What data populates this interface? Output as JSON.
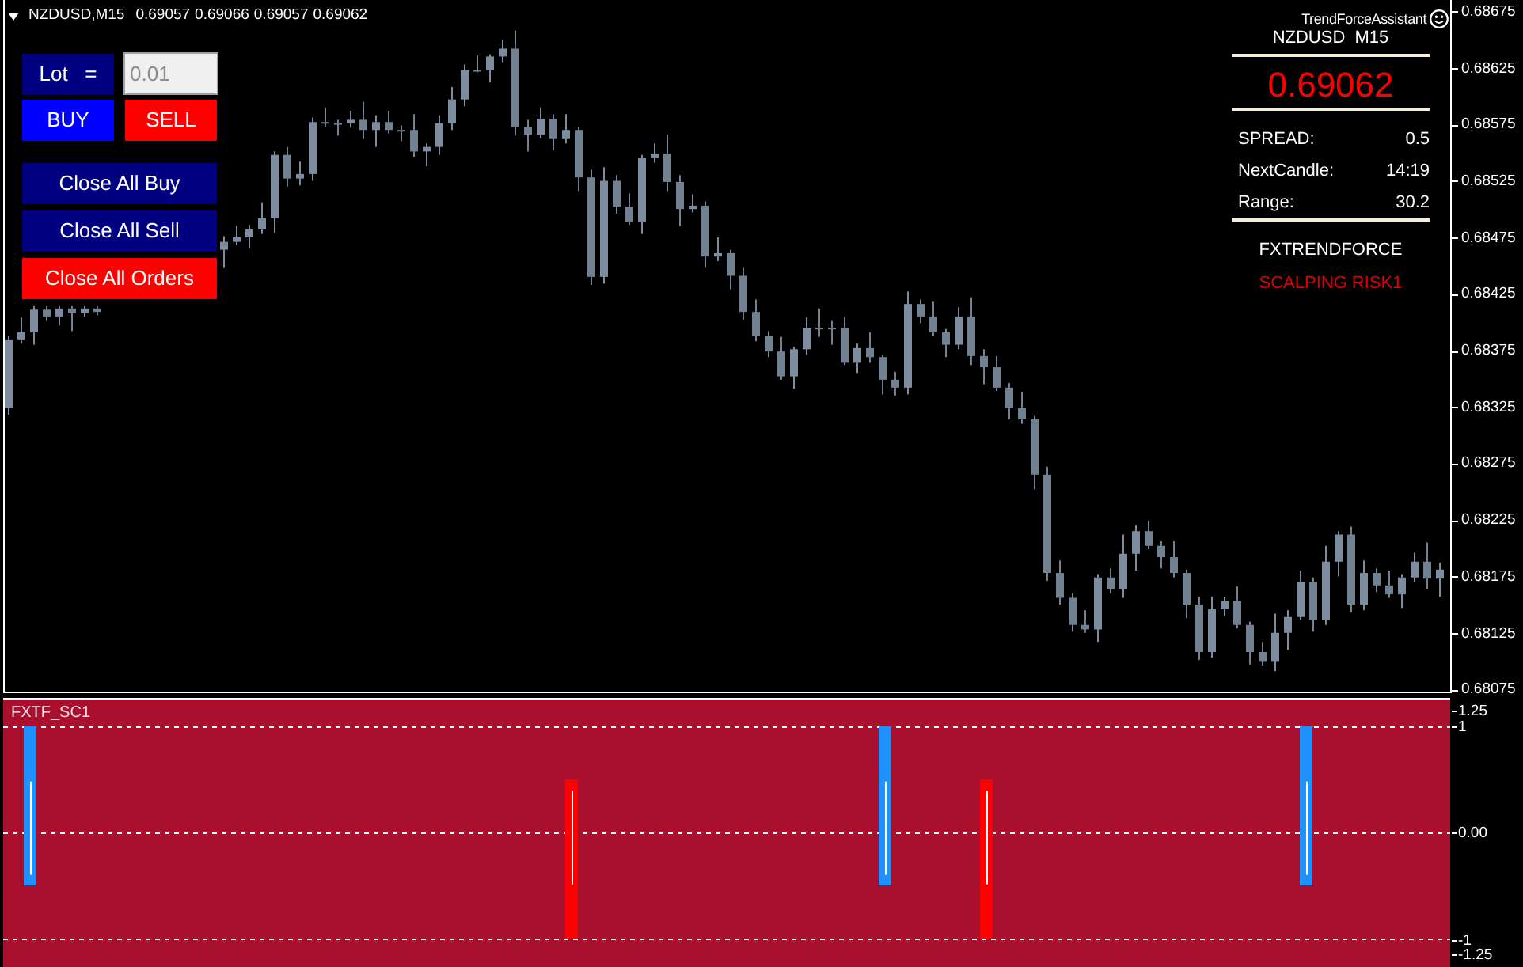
{
  "chart_header": {
    "symbol": "NZDUSD,M15",
    "quotes": [
      "0.69057",
      "0.69066",
      "0.69057",
      "0.69062"
    ]
  },
  "price_chart": {
    "chart_data": {
      "type": "candlestick",
      "ylim": [
        0.68074,
        0.68686
      ],
      "yticks": [
        0.68675,
        0.68625,
        0.68575,
        0.68525,
        0.68475,
        0.68425,
        0.68375,
        0.68325,
        0.68275,
        0.68225,
        0.68175,
        0.68125,
        0.68075
      ],
      "ohlc": [
        [
          0.68325,
          0.68389,
          0.68319,
          0.68385
        ],
        [
          0.68385,
          0.68405,
          0.68382,
          0.68392
        ],
        [
          0.68392,
          0.68415,
          0.68381,
          0.68412
        ],
        [
          0.68412,
          0.68415,
          0.68402,
          0.68406
        ],
        [
          0.68406,
          0.68415,
          0.68398,
          0.68413
        ],
        [
          0.68413,
          0.68415,
          0.68393,
          0.68409
        ],
        [
          0.68409,
          0.68415,
          0.68406,
          0.68413
        ],
        [
          0.68413,
          0.68415,
          0.68407,
          0.6841
        ],
        null,
        null,
        null,
        null,
        null,
        null,
        null,
        null,
        null,
        [
          0.68465,
          0.68477,
          0.68449,
          0.68472
        ],
        [
          0.68472,
          0.68486,
          0.68469,
          0.68476
        ],
        [
          0.68476,
          0.68487,
          0.68466,
          0.68483
        ],
        [
          0.68483,
          0.68507,
          0.68479,
          0.68493
        ],
        [
          0.68493,
          0.68552,
          0.6848,
          0.68549
        ],
        [
          0.68549,
          0.68556,
          0.68521,
          0.68528
        ],
        [
          0.68528,
          0.68543,
          0.68522,
          0.68532
        ],
        [
          0.68532,
          0.68582,
          0.68526,
          0.68578
        ],
        [
          0.68578,
          0.68591,
          0.68574,
          0.68577
        ],
        [
          0.68577,
          0.6858,
          0.68566,
          0.68577
        ],
        [
          0.68577,
          0.68588,
          0.68573,
          0.6858
        ],
        [
          0.6858,
          0.68596,
          0.68563,
          0.68571
        ],
        [
          0.68571,
          0.68584,
          0.68556,
          0.68578
        ],
        [
          0.68578,
          0.68588,
          0.68568,
          0.68571
        ],
        [
          0.68571,
          0.68575,
          0.68561,
          0.68571
        ],
        [
          0.68571,
          0.68585,
          0.68547,
          0.68552
        ],
        [
          0.68552,
          0.68559,
          0.68539,
          0.68556
        ],
        [
          0.68556,
          0.68584,
          0.68549,
          0.68577
        ],
        [
          0.68577,
          0.68609,
          0.68571,
          0.68598
        ],
        [
          0.68598,
          0.68629,
          0.68592,
          0.68624
        ],
        [
          0.68624,
          0.68637,
          0.68622,
          0.68624
        ],
        [
          0.68624,
          0.68638,
          0.68613,
          0.68636
        ],
        [
          0.68636,
          0.68651,
          0.68631,
          0.68643
        ],
        [
          0.68643,
          0.68659,
          0.68566,
          0.68574
        ],
        [
          0.68574,
          0.6858,
          0.68552,
          0.68567
        ],
        [
          0.68567,
          0.68591,
          0.68564,
          0.68581
        ],
        [
          0.68581,
          0.68585,
          0.68553,
          0.68563
        ],
        [
          0.68563,
          0.68585,
          0.68559,
          0.68571
        ],
        [
          0.68571,
          0.68574,
          0.68517,
          0.68529
        ],
        [
          0.68529,
          0.68536,
          0.68434,
          0.68441
        ],
        [
          0.68441,
          0.68538,
          0.68435,
          0.68526
        ],
        [
          0.68526,
          0.68531,
          0.68497,
          0.68503
        ],
        [
          0.68503,
          0.68515,
          0.68487,
          0.6849
        ],
        [
          0.6849,
          0.68549,
          0.68479,
          0.68546
        ],
        [
          0.68546,
          0.68559,
          0.68542,
          0.6855
        ],
        [
          0.6855,
          0.68567,
          0.68517,
          0.68525
        ],
        [
          0.68525,
          0.68531,
          0.68486,
          0.68501
        ],
        [
          0.68501,
          0.68514,
          0.68498,
          0.68504
        ],
        [
          0.68504,
          0.68508,
          0.68449,
          0.68459
        ],
        [
          0.68459,
          0.68476,
          0.68455,
          0.68462
        ],
        [
          0.68462,
          0.68465,
          0.6843,
          0.68442
        ],
        [
          0.68442,
          0.68449,
          0.68403,
          0.6841
        ],
        [
          0.6841,
          0.68421,
          0.68384,
          0.68389
        ],
        [
          0.68389,
          0.68393,
          0.6837,
          0.68375
        ],
        [
          0.68375,
          0.68388,
          0.6835,
          0.68353
        ],
        [
          0.68353,
          0.68379,
          0.68342,
          0.68377
        ],
        [
          0.68377,
          0.68405,
          0.68372,
          0.68396
        ],
        [
          0.68396,
          0.68413,
          0.68388,
          0.68396
        ],
        [
          0.68396,
          0.68402,
          0.68381,
          0.68396
        ],
        [
          0.68396,
          0.68406,
          0.68363,
          0.68365
        ],
        [
          0.68365,
          0.68382,
          0.68356,
          0.68378
        ],
        [
          0.68378,
          0.68392,
          0.68365,
          0.6837
        ],
        [
          0.6837,
          0.68372,
          0.68337,
          0.6835
        ],
        [
          0.6835,
          0.68357,
          0.68336,
          0.68343
        ],
        [
          0.68343,
          0.68428,
          0.68337,
          0.68417
        ],
        [
          0.68417,
          0.68421,
          0.684,
          0.68406
        ],
        [
          0.68406,
          0.68419,
          0.68389,
          0.68392
        ],
        [
          0.68392,
          0.68395,
          0.6837,
          0.68381
        ],
        [
          0.68381,
          0.68414,
          0.68377,
          0.68406
        ],
        [
          0.68406,
          0.68423,
          0.68363,
          0.68371
        ],
        [
          0.68371,
          0.68377,
          0.68346,
          0.68361
        ],
        [
          0.68361,
          0.68371,
          0.6834,
          0.68343
        ],
        [
          0.68343,
          0.68347,
          0.68315,
          0.68325
        ],
        [
          0.68325,
          0.68339,
          0.68311,
          0.68315
        ],
        [
          0.68315,
          0.68318,
          0.68253,
          0.68266
        ],
        [
          0.68266,
          0.68273,
          0.68172,
          0.68179
        ],
        [
          0.68179,
          0.6819,
          0.68151,
          0.68157
        ],
        [
          0.68157,
          0.68161,
          0.68127,
          0.68133
        ],
        [
          0.68133,
          0.68146,
          0.68126,
          0.68129
        ],
        [
          0.68129,
          0.68178,
          0.68118,
          0.68175
        ],
        [
          0.68175,
          0.68183,
          0.68161,
          0.68165
        ],
        [
          0.68165,
          0.68213,
          0.68157,
          0.68196
        ],
        [
          0.68196,
          0.68221,
          0.68181,
          0.68216
        ],
        [
          0.68216,
          0.68225,
          0.682,
          0.68203
        ],
        [
          0.68203,
          0.68207,
          0.68183,
          0.68193
        ],
        [
          0.68193,
          0.68207,
          0.68175,
          0.68179
        ],
        [
          0.68179,
          0.68182,
          0.68139,
          0.68151
        ],
        [
          0.68151,
          0.68158,
          0.68102,
          0.68109
        ],
        [
          0.68109,
          0.68158,
          0.68104,
          0.68147
        ],
        [
          0.68147,
          0.68158,
          0.68141,
          0.68154
        ],
        [
          0.68154,
          0.68167,
          0.6813,
          0.68133
        ],
        [
          0.68133,
          0.68136,
          0.68098,
          0.68109
        ],
        [
          0.68109,
          0.68118,
          0.68097,
          0.68101
        ],
        [
          0.68101,
          0.68143,
          0.68092,
          0.68126
        ],
        [
          0.68126,
          0.68146,
          0.68111,
          0.6814
        ],
        [
          0.6814,
          0.68181,
          0.68137,
          0.68171
        ],
        [
          0.68171,
          0.68175,
          0.68127,
          0.68137
        ],
        [
          0.68137,
          0.68203,
          0.68133,
          0.68189
        ],
        [
          0.68189,
          0.68216,
          0.68176,
          0.68213
        ],
        [
          0.68213,
          0.6822,
          0.68144,
          0.68151
        ],
        [
          0.68151,
          0.6819,
          0.68146,
          0.68179
        ],
        [
          0.68179,
          0.68183,
          0.68162,
          0.68168
        ],
        [
          0.68168,
          0.68181,
          0.68157,
          0.6816
        ],
        [
          0.6816,
          0.68178,
          0.68148,
          0.68175
        ],
        [
          0.68175,
          0.68197,
          0.68171,
          0.68189
        ],
        [
          0.68189,
          0.68206,
          0.68165,
          0.68174
        ],
        [
          0.68174,
          0.68188,
          0.68158,
          0.68182
        ]
      ]
    }
  },
  "trade_panel": {
    "lot_label": "Lot   =",
    "lot_field": {
      "value": "0.01"
    },
    "order_buttons": [
      {
        "label": "BUY",
        "color": "#0000ff"
      },
      {
        "label": "SELL",
        "color": "#ff0000"
      }
    ],
    "close_buttons": [
      {
        "label": "Close All Buy",
        "color": "#000080"
      },
      {
        "label": "Close All Sell",
        "color": "#000080"
      },
      {
        "label": "Close All Orders",
        "color": "#ff0000"
      }
    ]
  },
  "info_panel": {
    "title": "TrendForceAssistant",
    "symbol": "NZDUSD  M15",
    "price": "0.69062",
    "stats": [
      {
        "label": "SPREAD:",
        "value": "0.5"
      },
      {
        "label": "NextCandle:",
        "value": "14:19"
      },
      {
        "label": "Range:",
        "value": "30.2"
      }
    ],
    "brand": "FXTRENDFORCE",
    "mode": "SCALPING RISK1"
  },
  "indicator": {
    "name": "FXTF_SC1",
    "axis_labels": [
      "1.25",
      "1",
      "0.00",
      "-1",
      "-1.25"
    ]
  }
}
